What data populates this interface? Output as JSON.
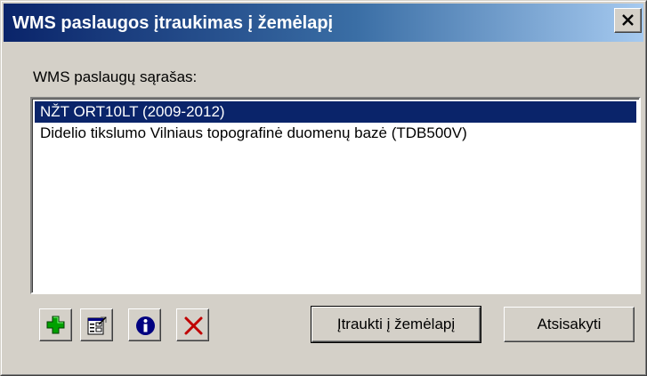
{
  "window": {
    "title": "WMS paslaugos įtraukimas į žemėlapį",
    "close_label": "X"
  },
  "list": {
    "label": "WMS paslaugų sąrašas:",
    "items": [
      {
        "label": "NŽT ORT10LT (2009-2012)",
        "selected": true
      },
      {
        "label": "Didelio tikslumo Vilniaus topografinė duomenų bazė (TDB500V)",
        "selected": false
      }
    ]
  },
  "toolbar": {
    "icons": [
      "add-icon",
      "properties-icon",
      "info-icon",
      "delete-icon"
    ],
    "colors": {
      "add": "#00a000",
      "info": "#000080",
      "delete": "#c00000"
    }
  },
  "buttons": {
    "add_to_map": "Įtraukti į žemėlapį",
    "cancel": "Atsisakyti"
  },
  "colors": {
    "face": "#d4d0c8",
    "title_start": "#0a246a",
    "title_end": "#a6caf0",
    "selection": "#0a246a"
  }
}
